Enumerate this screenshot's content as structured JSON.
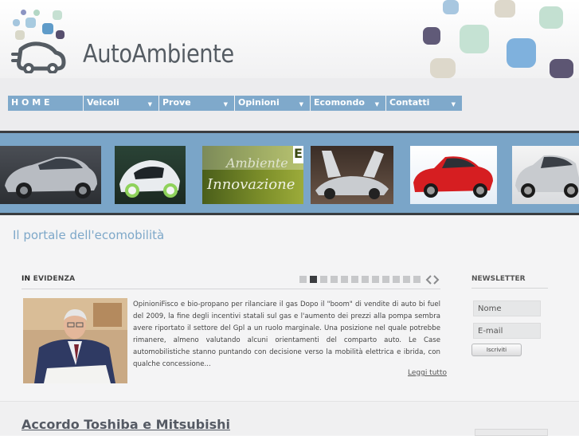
{
  "site": {
    "name": "AutoAmbiente"
  },
  "nav": [
    {
      "label": "H O M E",
      "has_dropdown": false
    },
    {
      "label": "Veicoli",
      "has_dropdown": true
    },
    {
      "label": "Prove",
      "has_dropdown": true
    },
    {
      "label": "Opinioni",
      "has_dropdown": true
    },
    {
      "label": "Ecomondo",
      "has_dropdown": true
    },
    {
      "label": "Contatti",
      "has_dropdown": true
    }
  ],
  "banner": {
    "thumbs": [
      "silver-hatchback",
      "white-concept-car",
      "ambiente-innovazione-panel",
      "silver-concept-gullwing",
      "red-sedan",
      "silver-suv"
    ],
    "panel_text": {
      "line1": "Ambiente",
      "line2": "Innovazione",
      "corner": "E"
    }
  },
  "tagline": "Il portale dell'ecomobilità",
  "featured": {
    "label_prefix": "IN",
    "label_rest": "EVIDENZA",
    "pager_count": 12,
    "pager_active": 1,
    "article_text": "OpinioniFisco e bio-propano per rilanciare il gas Dopo il \"boom\" di vendite di auto bi fuel del 2009, la fine degli incentivi statali sul gas e l'aumento dei prezzi alla pompa sembra avere riportato il settore del Gpl a un ruolo marginale. Una posizione nel quale potrebbe rimanere, almeno valutando alcuni orientamenti del comparto auto. Le Case automobilistiche stanno puntando con decisione verso la mobilità elettrica e ibrida, con qualche concessione...",
    "read_more": "Leggi tutto"
  },
  "newsletter": {
    "title": "NEWSLETTER",
    "name_value": "Nome",
    "email_value": "E-mail",
    "submit": "Iscriviti"
  },
  "headline": "Accordo Toshiba e Mitsubishi",
  "colors": {
    "accent": "#7fa9cb",
    "band": "#7aa5c8",
    "tagline": "#7ea8c9",
    "dark_bar": "#3a3d40"
  }
}
